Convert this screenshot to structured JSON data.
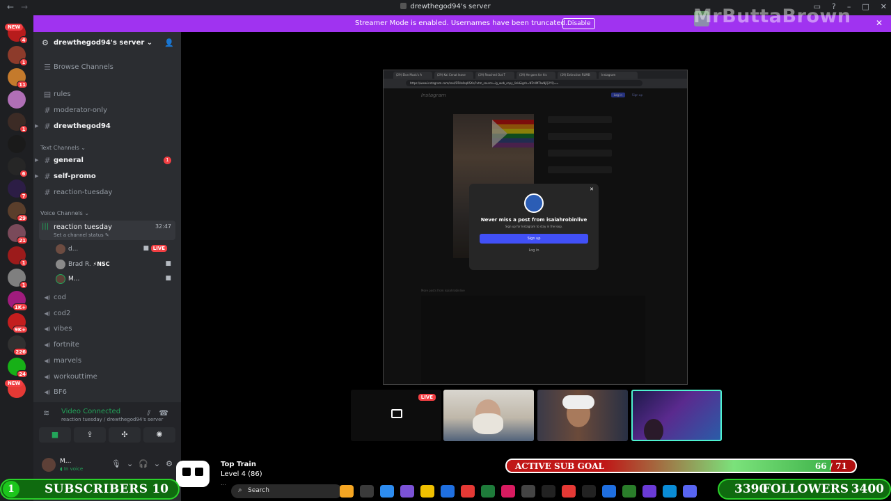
{
  "window": {
    "title": "drewthegod94's server",
    "back_icon": "←",
    "forward_icon": "→"
  },
  "banner": {
    "message": "Streamer Mode is enabled. Usernames have been truncated.",
    "button": "Disable"
  },
  "overlay_brand": "MrButtaBrown",
  "server_list": [
    {
      "color": "#b71c1c",
      "new": "NEW",
      "badge": "4"
    },
    {
      "color": "#8d3b2b",
      "badge": "1"
    },
    {
      "color": "#c47a2c",
      "badge": "11"
    },
    {
      "color": "#b06fb6",
      "badge": ""
    },
    {
      "color": "#3c2b25",
      "badge": "1"
    },
    {
      "color": "#1a1a1a",
      "badge": ""
    },
    {
      "color": "#262626",
      "badge": "6"
    },
    {
      "color": "#2c1d45",
      "badge": "7"
    },
    {
      "color": "#5a3e2b",
      "badge": "29"
    },
    {
      "color": "#7a4a5a",
      "badge": "21"
    },
    {
      "color": "#9c1b1b",
      "badge": "1"
    },
    {
      "color": "#7f7f7f",
      "badge": "1"
    },
    {
      "color": "#a01c7d",
      "badge": "1K+"
    },
    {
      "color": "#c41e1e",
      "badge": "9K+"
    },
    {
      "color": "#303030",
      "badge": "226"
    },
    {
      "color": "#17b017",
      "badge": "24"
    },
    {
      "color": "#e53935",
      "new": "NEW",
      "badge": ""
    }
  ],
  "sidebar": {
    "server_name": "drewthegod94's server",
    "browse": "Browse Channels",
    "top_channels": [
      {
        "icon": "▤",
        "label": "rules",
        "bright": false
      },
      {
        "icon": "#",
        "label": "moderator-only",
        "bright": false
      },
      {
        "icon": "#",
        "label": "drewthegod94",
        "bright": true
      }
    ],
    "text_category": "Text Channels",
    "text_channels": [
      {
        "label": "general",
        "bright": true,
        "badge": "1"
      },
      {
        "label": "self-promo",
        "bright": true,
        "badge": ""
      },
      {
        "label": "reaction-tuesday",
        "bright": false,
        "badge": ""
      }
    ],
    "voice_category": "Voice Channels",
    "active_voice": {
      "label": "reaction tuesday",
      "time": "32:47",
      "status": "Set a channel status"
    },
    "voice_members": [
      {
        "name": "d...",
        "live": "LIVE"
      },
      {
        "name": "Brad R.",
        "tag": "⚡NSC"
      },
      {
        "name": "M..."
      }
    ],
    "voice_channels": [
      "cod",
      "cod2",
      "vibes",
      "fortnite",
      "marvels",
      "workouttime",
      "BF6"
    ]
  },
  "voice_connected": {
    "title": "Video Connected",
    "sub": "reaction tuesday / drewthegod94's server"
  },
  "user": {
    "name": "M...",
    "status": "In voice"
  },
  "stream": {
    "tabs": [
      "(29) Elon Musk's A",
      "(29) Kai Cenat leave",
      "(29) Reached Out T",
      "(29) He goes for his",
      "(29) Extinction RUMB",
      "Instagram"
    ],
    "url": "https://www.instagram.com/reel/DTsb4sqKSXs/?utm_source=ig_web_copy_link&igsh=NTc4MTIwNjQ2YQ==",
    "ig_logo": "Instagram",
    "login_btn": "Log in",
    "signup_btn": "Sign up",
    "modal_title": "Never miss a post from isaiahrobinlive",
    "modal_sub": "Sign up for Instagram to stay in the loop.",
    "modal_signup": "Sign up",
    "modal_login": "Log in",
    "more_posts": "More posts from isaiahrobinlive"
  },
  "tiles": {
    "live": "LIVE"
  },
  "top_train": {
    "title": "Top Train",
    "level": "Level 4 (86)",
    "sub": "..."
  },
  "sub_goal": {
    "label": "ACTIVE SUB GOAL",
    "current": 66,
    "target": 71,
    "text": "66 / 71"
  },
  "taskbar": {
    "search": "Search",
    "apps": [
      {
        "color": "#f5a623"
      },
      {
        "color": "#3a3a3a"
      },
      {
        "color": "#2d8cf0"
      },
      {
        "color": "#7b52d6"
      },
      {
        "color": "#f0c000"
      },
      {
        "color": "#1f6fe0"
      },
      {
        "color": "#e53935"
      },
      {
        "color": "#1e7b3a"
      },
      {
        "color": "#d81b60"
      },
      {
        "color": "#444444"
      },
      {
        "color": "#222222"
      },
      {
        "color": "#e53935"
      },
      {
        "color": "#222222"
      },
      {
        "color": "#1f6fe0"
      },
      {
        "color": "#2a7d2a"
      },
      {
        "color": "#6a3ad6"
      },
      {
        "color": "#0a8cd6"
      },
      {
        "color": "#5865f2"
      }
    ]
  },
  "subscribers": {
    "badge": "1",
    "label": "SUBSCRIBERS",
    "count": "10"
  },
  "followers": {
    "current": "3390",
    "label": "FOLLOWERS",
    "target": "3400"
  }
}
